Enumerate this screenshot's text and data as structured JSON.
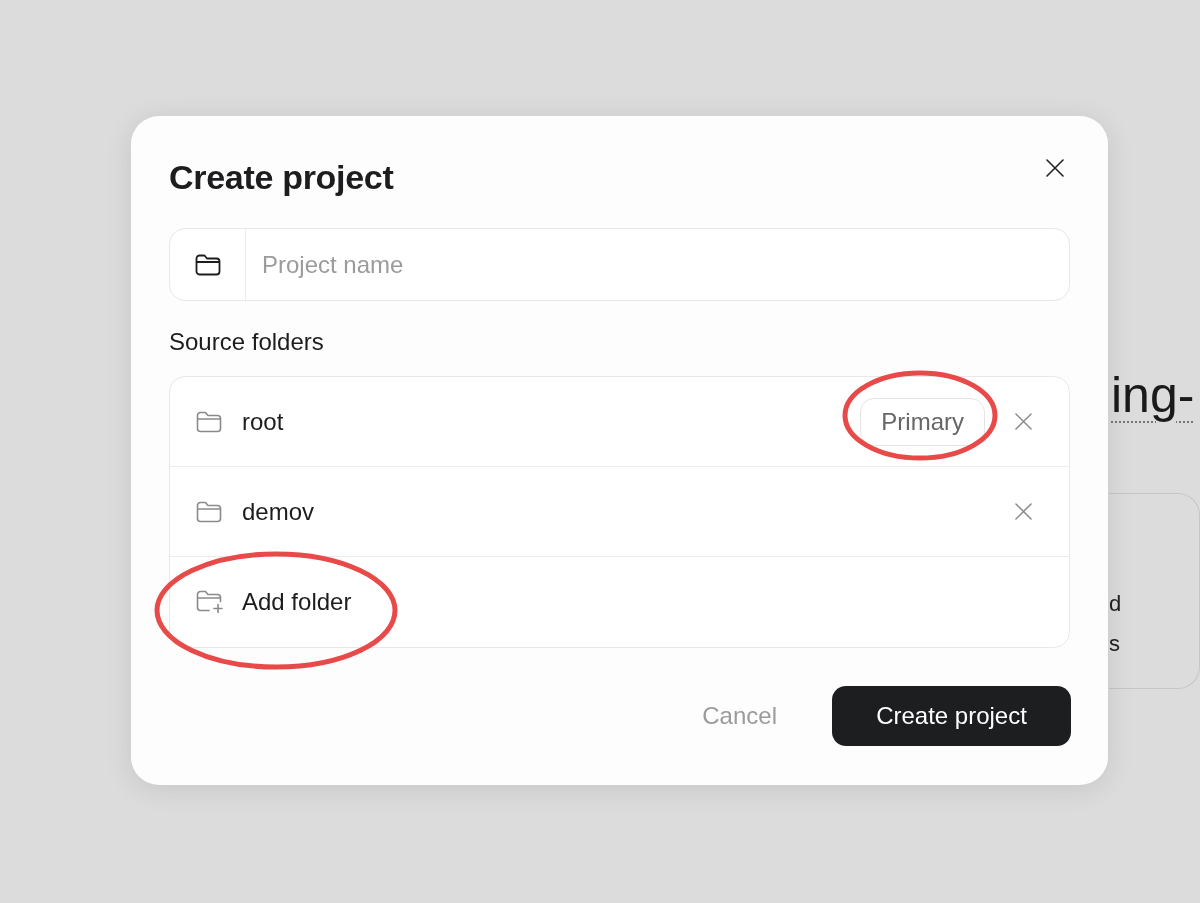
{
  "background": {
    "heading": "ing-",
    "card": {
      "lines": [
        "d",
        "s"
      ]
    }
  },
  "dialog": {
    "title": "Create project",
    "name_field": {
      "placeholder": "Project name"
    },
    "source_folders": {
      "label": "Source folders",
      "folders": [
        {
          "name": "root",
          "badge": "Primary",
          "circled": true,
          "removable": true
        },
        {
          "name": "demov",
          "circled": false,
          "removable": true
        }
      ],
      "add_folder": {
        "label": "Add folder",
        "circled": true
      }
    },
    "buttons": [
      {
        "label": "Cancel",
        "kind": "secondary"
      },
      {
        "label": "Create project",
        "kind": "primary"
      }
    ]
  }
}
